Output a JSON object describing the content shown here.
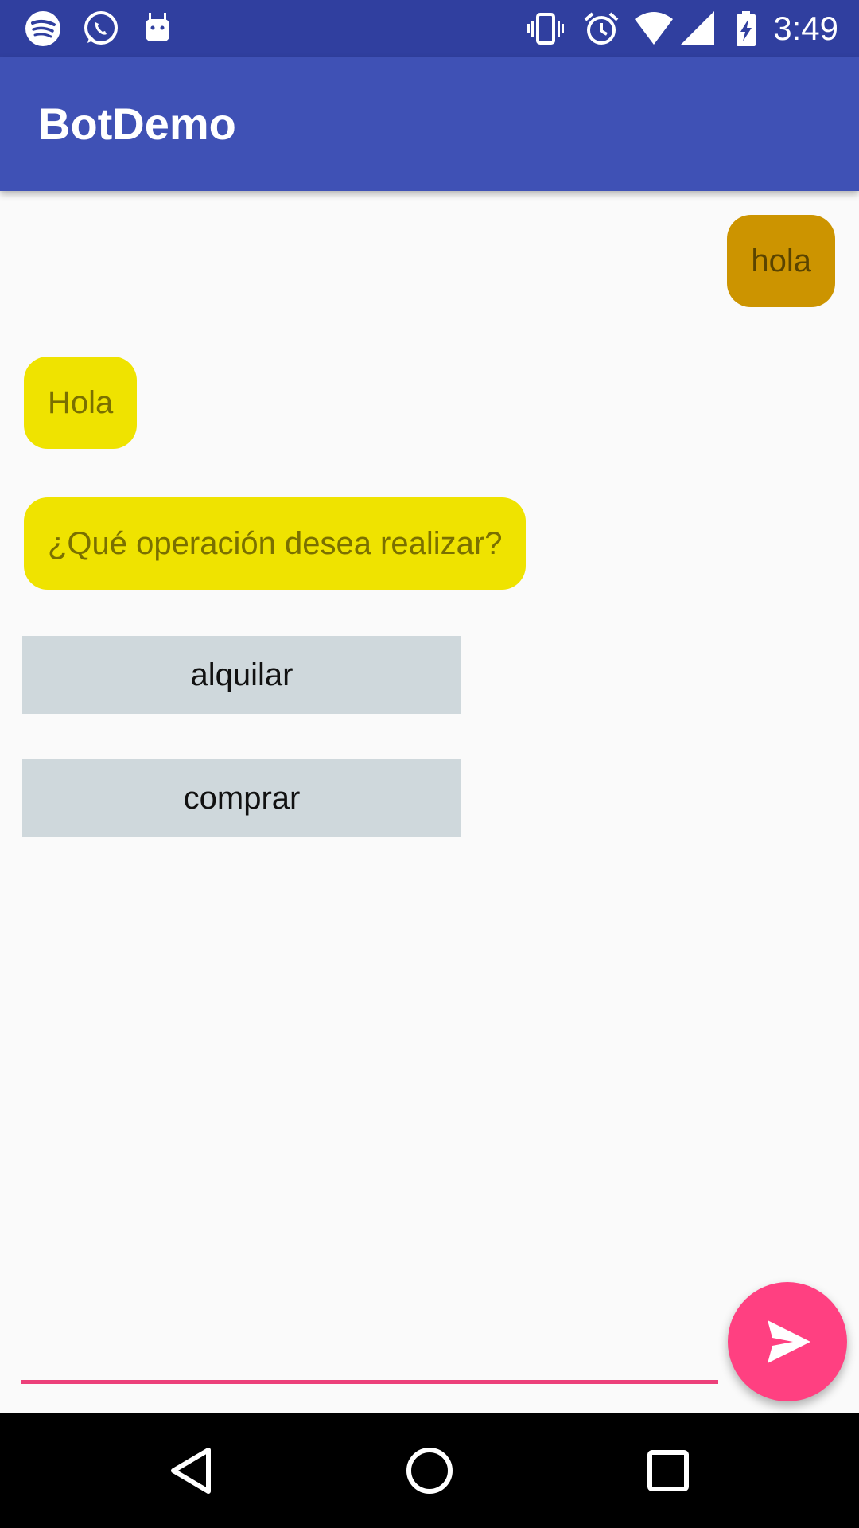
{
  "status_bar": {
    "time": "3:49",
    "notification_icons": [
      "spotify-icon",
      "whatsapp-icon",
      "android-debug-icon"
    ],
    "system_icons": [
      "vibrate-icon",
      "alarm-icon",
      "wifi-icon",
      "signal-icon",
      "battery-charging-icon"
    ]
  },
  "app_bar": {
    "title": "BotDemo"
  },
  "chat": {
    "messages": [
      {
        "sender": "user",
        "text": "hola"
      },
      {
        "sender": "bot",
        "text": "Hola"
      },
      {
        "sender": "bot",
        "text": "¿Qué operación desea realizar?"
      }
    ],
    "options": [
      {
        "label": "alquilar"
      },
      {
        "label": "comprar"
      }
    ]
  },
  "composer": {
    "value": "",
    "placeholder": "",
    "send_icon": "send-icon"
  },
  "nav_bar": {
    "icons": [
      "back-icon",
      "home-icon",
      "recent-apps-icon"
    ]
  },
  "colors": {
    "status_bar": "#303f9f",
    "app_bar": "#3f51b5",
    "user_bubble": "#cc9400",
    "bot_bubble": "#efe300",
    "option_button": "#cfd8dc",
    "accent": "#ff4081"
  }
}
